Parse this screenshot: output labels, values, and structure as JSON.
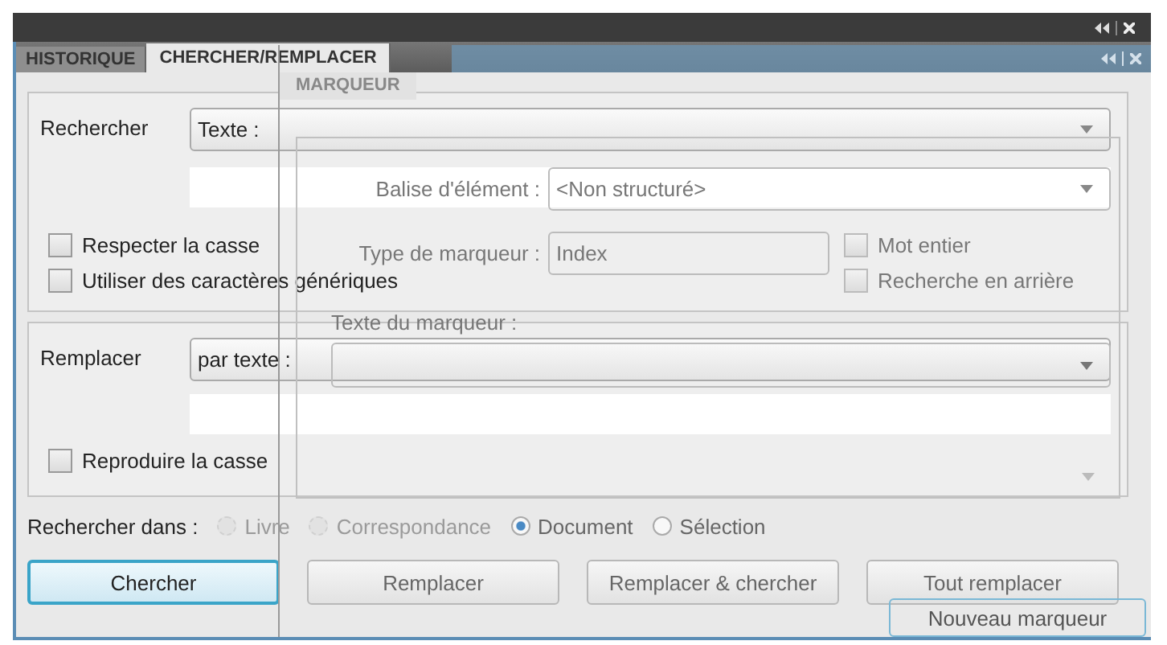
{
  "tabs": [
    {
      "label": "HISTORIQUE",
      "selected": false
    },
    {
      "label": "CHERCHER/REMPLACER",
      "selected": true
    }
  ],
  "find": {
    "label": "Rechercher",
    "mode": "Texte :",
    "options": [
      {
        "label": "Respecter la casse",
        "checked": false
      },
      {
        "label": "Utiliser des caractères génériques",
        "checked": false
      }
    ],
    "right_options": [
      {
        "label": "Mot entier",
        "checked": false
      },
      {
        "label": "Recherche en arrière",
        "checked": false
      }
    ]
  },
  "replace": {
    "label": "Remplacer",
    "mode": "par texte :",
    "options": [
      {
        "label": "Reproduire la casse",
        "checked": false
      }
    ]
  },
  "search_in": {
    "label": "Rechercher dans :",
    "options": [
      {
        "label": "Livre",
        "selected": false,
        "disabled": true
      },
      {
        "label": "Correspondance",
        "selected": false,
        "disabled": true
      },
      {
        "label": "Document",
        "selected": true,
        "disabled": false
      },
      {
        "label": "Sélection",
        "selected": false,
        "disabled": false
      }
    ]
  },
  "buttons": [
    {
      "label": "Chercher",
      "default": true
    },
    {
      "label": "Remplacer",
      "default": false
    },
    {
      "label": "Remplacer & chercher",
      "default": false
    },
    {
      "label": "Tout remplacer",
      "default": false
    }
  ],
  "marker_panel": {
    "tab": "MARQUEUR",
    "fields": [
      {
        "label": "Balise d'élément :",
        "value": "<Non structuré>"
      },
      {
        "label": "Type de marqueur :",
        "value": "Index"
      }
    ],
    "text_label": "Texte du marqueur :",
    "button": "Nouveau marqueur"
  }
}
